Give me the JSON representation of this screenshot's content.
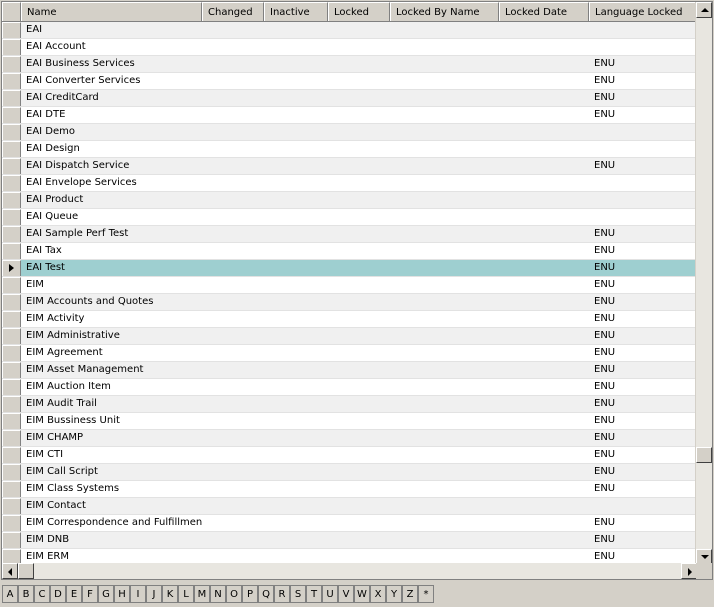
{
  "columns": [
    "Name",
    "Changed",
    "Inactive",
    "Locked",
    "Locked By Name",
    "Locked Date",
    "Language Locked"
  ],
  "rows": [
    {
      "name": "EAI",
      "lang": ""
    },
    {
      "name": "EAI Account",
      "lang": ""
    },
    {
      "name": "EAI Business Services",
      "lang": "ENU"
    },
    {
      "name": "EAI Converter Services",
      "lang": "ENU"
    },
    {
      "name": "EAI CreditCard",
      "lang": "ENU"
    },
    {
      "name": "EAI DTE",
      "lang": "ENU"
    },
    {
      "name": "EAI Demo",
      "lang": ""
    },
    {
      "name": "EAI Design",
      "lang": ""
    },
    {
      "name": "EAI Dispatch Service",
      "lang": "ENU"
    },
    {
      "name": "EAI Envelope Services",
      "lang": ""
    },
    {
      "name": "EAI Product",
      "lang": ""
    },
    {
      "name": "EAI Queue",
      "lang": ""
    },
    {
      "name": "EAI Sample Perf Test",
      "lang": "ENU"
    },
    {
      "name": "EAI Tax",
      "lang": "ENU"
    },
    {
      "name": "EAI Test",
      "lang": "ENU",
      "selected": true
    },
    {
      "name": "EIM",
      "lang": "ENU"
    },
    {
      "name": "EIM Accounts and Quotes",
      "lang": "ENU"
    },
    {
      "name": "EIM Activity",
      "lang": "ENU"
    },
    {
      "name": "EIM Administrative",
      "lang": "ENU"
    },
    {
      "name": "EIM Agreement",
      "lang": "ENU"
    },
    {
      "name": "EIM Asset Management",
      "lang": "ENU"
    },
    {
      "name": "EIM Auction Item",
      "lang": "ENU"
    },
    {
      "name": "EIM Audit Trail",
      "lang": "ENU"
    },
    {
      "name": "EIM Bussiness Unit",
      "lang": "ENU"
    },
    {
      "name": "EIM CHAMP",
      "lang": "ENU"
    },
    {
      "name": "EIM CTI",
      "lang": "ENU"
    },
    {
      "name": "EIM Call Script",
      "lang": "ENU"
    },
    {
      "name": "EIM Class Systems",
      "lang": "ENU"
    },
    {
      "name": "EIM Contact",
      "lang": ""
    },
    {
      "name": "EIM Correspondence and Fulfillment",
      "lang": "ENU"
    },
    {
      "name": "EIM DNB",
      "lang": "ENU"
    },
    {
      "name": "EIM ERM",
      "lang": "ENU"
    }
  ],
  "alphabet": [
    "A",
    "B",
    "C",
    "D",
    "E",
    "F",
    "G",
    "H",
    "I",
    "J",
    "K",
    "L",
    "M",
    "N",
    "O",
    "P",
    "Q",
    "R",
    "S",
    "T",
    "U",
    "V",
    "W",
    "X",
    "Y",
    "Z",
    "*"
  ],
  "colors": {
    "selected_row": "#9ecfd0",
    "alt_row": "#f0f0f0",
    "chrome": "#d4d0c8"
  }
}
